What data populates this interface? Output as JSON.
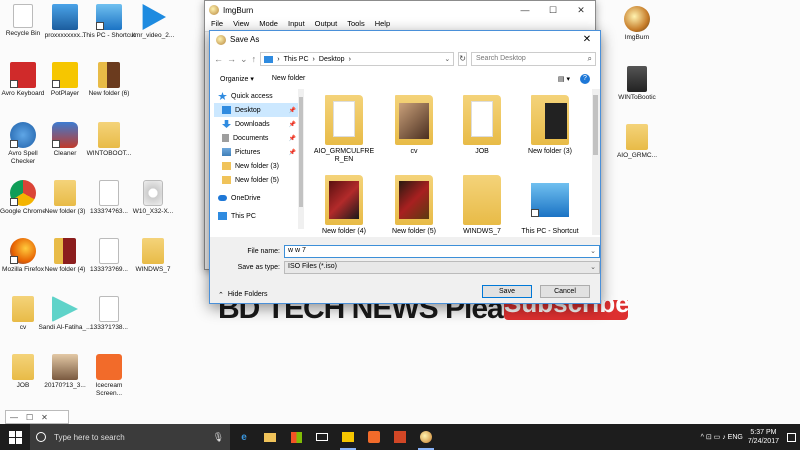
{
  "desktop": {
    "icons": [
      {
        "label": "Recycle Bin"
      },
      {
        "label": "proxxxxxxxx..."
      },
      {
        "label": "This PC - Shortcut"
      },
      {
        "label": "kmr_video_2..."
      },
      {
        "label": "Avro Keyboard"
      },
      {
        "label": "PotPlayer"
      },
      {
        "label": "New folder (6)"
      },
      {
        "label": "Avro Spell Checker"
      },
      {
        "label": "Cleaner"
      },
      {
        "label": "WINTOBOOT..."
      },
      {
        "label": "Google Chrome"
      },
      {
        "label": "New folder (3)"
      },
      {
        "label": "1333?4?63..."
      },
      {
        "label": "W10_X32-X..."
      },
      {
        "label": "Mozilla Firefox"
      },
      {
        "label": "New folder (4)"
      },
      {
        "label": "1333?3?69..."
      },
      {
        "label": "WINDWS_7"
      },
      {
        "label": "cv"
      },
      {
        "label": "Sandi Al-Fatiha_..."
      },
      {
        "label": "1333?1?38..."
      },
      {
        "label": "JOB"
      },
      {
        "label": "20170?13_3..."
      },
      {
        "label": "Icecream Screen..."
      },
      {
        "label": "ImgBurn"
      },
      {
        "label": "WINToBootic"
      },
      {
        "label": "AIO_GRMC..."
      }
    ]
  },
  "imgburn": {
    "title": "ImgBurn",
    "menu": [
      "File",
      "View",
      "Mode",
      "Input",
      "Output",
      "Tools",
      "Help"
    ],
    "controls": [
      "—",
      "☐",
      "✕"
    ]
  },
  "dialog": {
    "title": "Save As",
    "close": "✕",
    "nav": {
      "back": "←",
      "forward": "→",
      "down": "⌄",
      "up": "↑"
    },
    "address": {
      "path": [
        "This PC",
        "Desktop"
      ],
      "sep": "›",
      "dropdown": "⌄"
    },
    "refresh": "↻",
    "search_placeholder": "Search Desktop",
    "search_icon": "⌕",
    "organize": "Organize ▾",
    "new_folder": "New folder",
    "view_icon": "▤ ▾",
    "help": "?",
    "nav_items": [
      {
        "label": "Quick access",
        "color": "#2f8be0"
      },
      {
        "label": "Desktop",
        "color": "#2f8be0",
        "pinned": "📌"
      },
      {
        "label": "Downloads",
        "color": "#2f8be0",
        "pinned": "📌"
      },
      {
        "label": "Documents",
        "color": "#8e8e8e",
        "pinned": "📌"
      },
      {
        "label": "Pictures",
        "color": "#6fa8dc",
        "pinned": "📌"
      },
      {
        "label": "New folder (3)",
        "color": "#f0c35a"
      },
      {
        "label": "New folder (5)",
        "color": "#f0c35a"
      },
      {
        "label": "OneDrive",
        "color": "#1e78d7"
      },
      {
        "label": "This PC",
        "color": "#2f8be0"
      }
    ],
    "files": [
      {
        "label": "AIO_GRMCULFRE R_EN"
      },
      {
        "label": "cv"
      },
      {
        "label": "JOB"
      },
      {
        "label": "New folder (3)"
      },
      {
        "label": "New folder (4)"
      },
      {
        "label": "New folder (5)"
      },
      {
        "label": "WINDWS_7"
      },
      {
        "label": "This PC - Shortcut"
      }
    ],
    "file_name_label": "File name:",
    "file_name_value": "w w 7",
    "save_type_label": "Save as type:",
    "save_type_value": "ISO Files (*.iso)",
    "hide_folders": "Hide Folders",
    "hide_icon": "⌃",
    "save": "Save",
    "cancel": "Cancel"
  },
  "banner": {
    "text": "BD TECH NEWS Please",
    "subscribe": "Subscribe"
  },
  "mini_window": {
    "controls": [
      "—",
      "☐",
      "✕"
    ]
  },
  "taskbar": {
    "search_placeholder": "Type here to search",
    "mic": "🎙",
    "time": "5:37 PM",
    "date": "7/24/2017",
    "tray": "^ ⊡ ▭ ♪ ENG"
  },
  "colors": {
    "taskbar": "#1d1d1d",
    "accent": "#0078d7",
    "selection": "#cce8ff",
    "subscribe": "#dd3030"
  }
}
